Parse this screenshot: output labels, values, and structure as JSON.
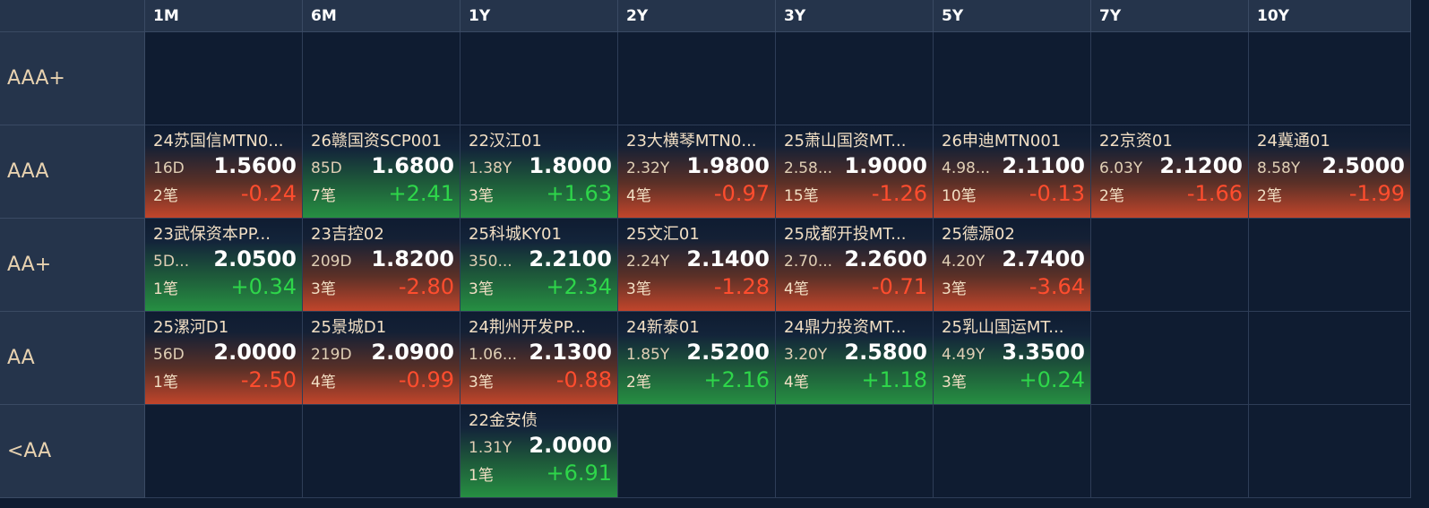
{
  "columns": [
    "1M",
    "6M",
    "1Y",
    "2Y",
    "3Y",
    "5Y",
    "7Y",
    "10Y"
  ],
  "rows": [
    "AAA+",
    "AAA",
    "AA+",
    "AA",
    "<AA"
  ],
  "colors": {
    "up": "#2ed64a",
    "down": "#ff4d2e",
    "header_bg": "#25344b",
    "cell_bg": "#0f1c31"
  },
  "cells": [
    [
      null,
      null,
      null,
      null,
      null,
      null,
      null,
      null
    ],
    [
      {
        "name": "24苏国信MTN0...",
        "term": "16D",
        "yield": "1.5600",
        "count": "2笔",
        "change": "-0.24",
        "dir": "down"
      },
      {
        "name": "26赣国资SCP001",
        "term": "85D",
        "yield": "1.6800",
        "count": "7笔",
        "change": "+2.41",
        "dir": "up"
      },
      {
        "name": "22汉江01",
        "term": "1.38Y",
        "yield": "1.8000",
        "count": "3笔",
        "change": "+1.63",
        "dir": "up"
      },
      {
        "name": "23大横琴MTN0...",
        "term": "2.32Y",
        "yield": "1.9800",
        "count": "4笔",
        "change": "-0.97",
        "dir": "down"
      },
      {
        "name": "25萧山国资MT...",
        "term": "2.58...",
        "yield": "1.9000",
        "count": "15笔",
        "change": "-1.26",
        "dir": "down"
      },
      {
        "name": "26申迪MTN001",
        "term": "4.98...",
        "yield": "2.1100",
        "count": "10笔",
        "change": "-0.13",
        "dir": "down"
      },
      {
        "name": "22京资01",
        "term": "6.03Y",
        "yield": "2.1200",
        "count": "2笔",
        "change": "-1.66",
        "dir": "down"
      },
      {
        "name": "24冀通01",
        "term": "8.58Y",
        "yield": "2.5000",
        "count": "2笔",
        "change": "-1.99",
        "dir": "down"
      }
    ],
    [
      {
        "name": "23武保资本PP...",
        "term": "5D...",
        "yield": "2.0500",
        "count": "1笔",
        "change": "+0.34",
        "dir": "up"
      },
      {
        "name": "23吉控02",
        "term": "209D",
        "yield": "1.8200",
        "count": "3笔",
        "change": "-2.80",
        "dir": "down"
      },
      {
        "name": "25科城KY01",
        "term": "350...",
        "yield": "2.2100",
        "count": "3笔",
        "change": "+2.34",
        "dir": "up"
      },
      {
        "name": "25文汇01",
        "term": "2.24Y",
        "yield": "2.1400",
        "count": "3笔",
        "change": "-1.28",
        "dir": "down"
      },
      {
        "name": "25成都开投MT...",
        "term": "2.70...",
        "yield": "2.2600",
        "count": "4笔",
        "change": "-0.71",
        "dir": "down"
      },
      {
        "name": "25德源02",
        "term": "4.20Y",
        "yield": "2.7400",
        "count": "3笔",
        "change": "-3.64",
        "dir": "down"
      },
      null,
      null
    ],
    [
      {
        "name": "25漯河D1",
        "term": "56D",
        "yield": "2.0000",
        "count": "1笔",
        "change": "-2.50",
        "dir": "down"
      },
      {
        "name": "25景城D1",
        "term": "219D",
        "yield": "2.0900",
        "count": "4笔",
        "change": "-0.99",
        "dir": "down"
      },
      {
        "name": "24荆州开发PP...",
        "term": "1.06...",
        "yield": "2.1300",
        "count": "3笔",
        "change": "-0.88",
        "dir": "down"
      },
      {
        "name": "24新泰01",
        "term": "1.85Y",
        "yield": "2.5200",
        "count": "2笔",
        "change": "+2.16",
        "dir": "up"
      },
      {
        "name": "24鼎力投资MT...",
        "term": "3.20Y",
        "yield": "2.5800",
        "count": "4笔",
        "change": "+1.18",
        "dir": "up"
      },
      {
        "name": "25乳山国运MT...",
        "term": "4.49Y",
        "yield": "3.3500",
        "count": "3笔",
        "change": "+0.24",
        "dir": "up"
      },
      null,
      null
    ],
    [
      null,
      null,
      {
        "name": "22金安债",
        "term": "1.31Y",
        "yield": "2.0000",
        "count": "1笔",
        "change": "+6.91",
        "dir": "up"
      },
      null,
      null,
      null,
      null,
      null
    ]
  ]
}
